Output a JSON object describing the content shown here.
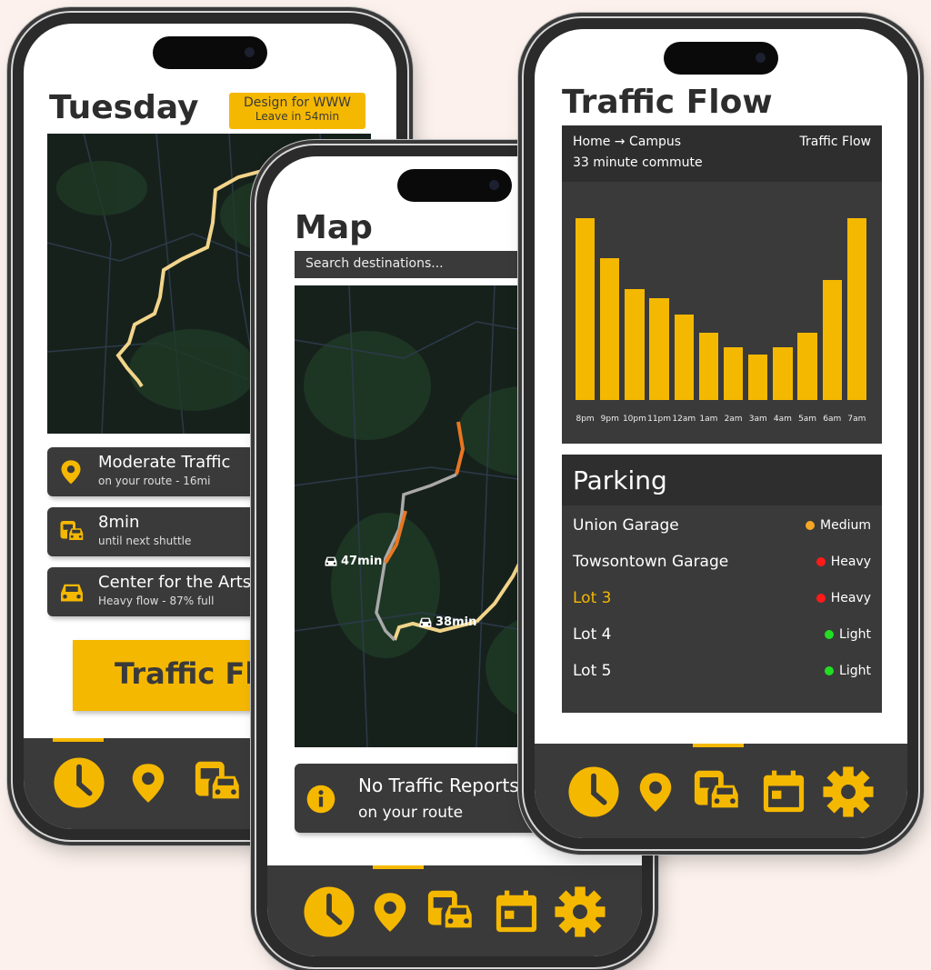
{
  "phone_left": {
    "title": "Tuesday",
    "event_badge": {
      "line1": "Design for WWW",
      "line2": "Leave in 54min"
    },
    "cards": [
      {
        "icon": "location-pin-icon",
        "title": "Moderate Traffic",
        "subtitle": "on your route - 16mi"
      },
      {
        "icon": "shuttle-car-icon",
        "title": "8min",
        "subtitle": "until next shuttle"
      },
      {
        "icon": "car-icon",
        "title": "Center for the Arts",
        "subtitle": "Heavy flow - 87% full"
      }
    ],
    "traffic_button": "Traffic Flow",
    "nav": [
      "clock-icon",
      "location-pin-icon",
      "shuttle-car-icon"
    ]
  },
  "phone_middle": {
    "title": "Map",
    "search": {
      "placeholder": "Search destinations..."
    },
    "route_labels": [
      {
        "time": "47min"
      },
      {
        "time": "38min"
      }
    ],
    "alert": {
      "title": "No Traffic Reports",
      "subtitle": "on your route"
    },
    "nav": [
      "clock-icon",
      "location-pin-icon",
      "shuttle-car-icon",
      "calendar-icon",
      "gear-icon"
    ]
  },
  "phone_right": {
    "title": "Traffic Flow",
    "route": {
      "from_to": "Home → Campus",
      "label": "Traffic Flow",
      "commute": "33 minute commute"
    },
    "chart_data": {
      "type": "bar",
      "categories": [
        "8pm",
        "9pm",
        "10pm",
        "11pm",
        "12am",
        "1am",
        "2am",
        "3am",
        "4am",
        "5am",
        "6am",
        "7am"
      ],
      "values": [
        100,
        78,
        61,
        56,
        47,
        37,
        29,
        25,
        29,
        37,
        66,
        100
      ],
      "title": "",
      "xlabel": "",
      "ylabel": "",
      "ylim": [
        0,
        100
      ],
      "color": "#f5b800"
    },
    "parking": {
      "title": "Parking",
      "rows": [
        {
          "name": "Union Garage",
          "level": "Medium",
          "color": "#f5a623",
          "highlight": false
        },
        {
          "name": "Towsontown Garage",
          "level": "Heavy",
          "color": "#ff1a1a",
          "highlight": false
        },
        {
          "name": "Lot 3",
          "level": "Heavy",
          "color": "#ff1a1a",
          "highlight": true
        },
        {
          "name": "Lot 4",
          "level": "Light",
          "color": "#22dd22",
          "highlight": false
        },
        {
          "name": "Lot 5",
          "level": "Light",
          "color": "#22dd22",
          "highlight": false
        }
      ]
    },
    "nav": [
      "clock-icon",
      "location-pin-icon",
      "shuttle-car-icon",
      "calendar-icon",
      "gear-icon"
    ]
  },
  "colors": {
    "accent": "#f5b800",
    "dark": "#3a3a3a",
    "route": "#f2d58a",
    "traffic": "#e87722"
  }
}
